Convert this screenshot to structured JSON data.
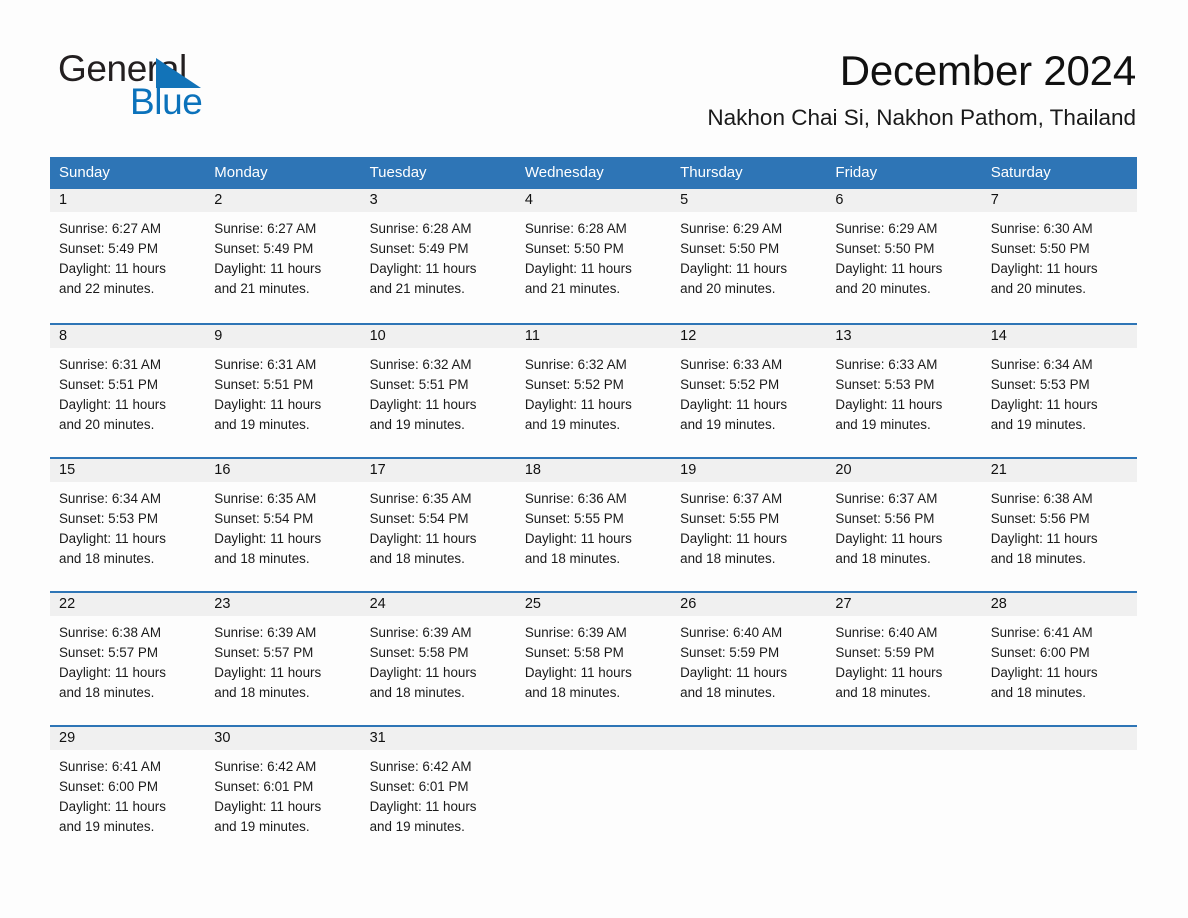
{
  "brand": {
    "word_general": "General",
    "word_blue": "Blue",
    "logo_icon": "triangle-logo-icon",
    "accent_color": "#0b72bb"
  },
  "header": {
    "title": "December 2024",
    "subtitle": "Nakhon Chai Si, Nakhon Pathom, Thailand"
  },
  "theme": {
    "header_blue": "#2e75b6",
    "row_divider_blue": "#2e75b6",
    "daynum_band_gray": "#f0f0f0",
    "page_background": "#fdfdfd"
  },
  "calendar": {
    "weekday_headers": [
      "Sunday",
      "Monday",
      "Tuesday",
      "Wednesday",
      "Thursday",
      "Friday",
      "Saturday"
    ],
    "weeks": [
      [
        {
          "day": "1",
          "sunrise": "Sunrise: 6:27 AM",
          "sunset": "Sunset: 5:49 PM",
          "daylight_line1": "Daylight: 11 hours",
          "daylight_line2": "and 22 minutes."
        },
        {
          "day": "2",
          "sunrise": "Sunrise: 6:27 AM",
          "sunset": "Sunset: 5:49 PM",
          "daylight_line1": "Daylight: 11 hours",
          "daylight_line2": "and 21 minutes."
        },
        {
          "day": "3",
          "sunrise": "Sunrise: 6:28 AM",
          "sunset": "Sunset: 5:49 PM",
          "daylight_line1": "Daylight: 11 hours",
          "daylight_line2": "and 21 minutes."
        },
        {
          "day": "4",
          "sunrise": "Sunrise: 6:28 AM",
          "sunset": "Sunset: 5:50 PM",
          "daylight_line1": "Daylight: 11 hours",
          "daylight_line2": "and 21 minutes."
        },
        {
          "day": "5",
          "sunrise": "Sunrise: 6:29 AM",
          "sunset": "Sunset: 5:50 PM",
          "daylight_line1": "Daylight: 11 hours",
          "daylight_line2": "and 20 minutes."
        },
        {
          "day": "6",
          "sunrise": "Sunrise: 6:29 AM",
          "sunset": "Sunset: 5:50 PM",
          "daylight_line1": "Daylight: 11 hours",
          "daylight_line2": "and 20 minutes."
        },
        {
          "day": "7",
          "sunrise": "Sunrise: 6:30 AM",
          "sunset": "Sunset: 5:50 PM",
          "daylight_line1": "Daylight: 11 hours",
          "daylight_line2": "and 20 minutes."
        }
      ],
      [
        {
          "day": "8",
          "sunrise": "Sunrise: 6:31 AM",
          "sunset": "Sunset: 5:51 PM",
          "daylight_line1": "Daylight: 11 hours",
          "daylight_line2": "and 20 minutes."
        },
        {
          "day": "9",
          "sunrise": "Sunrise: 6:31 AM",
          "sunset": "Sunset: 5:51 PM",
          "daylight_line1": "Daylight: 11 hours",
          "daylight_line2": "and 19 minutes."
        },
        {
          "day": "10",
          "sunrise": "Sunrise: 6:32 AM",
          "sunset": "Sunset: 5:51 PM",
          "daylight_line1": "Daylight: 11 hours",
          "daylight_line2": "and 19 minutes."
        },
        {
          "day": "11",
          "sunrise": "Sunrise: 6:32 AM",
          "sunset": "Sunset: 5:52 PM",
          "daylight_line1": "Daylight: 11 hours",
          "daylight_line2": "and 19 minutes."
        },
        {
          "day": "12",
          "sunrise": "Sunrise: 6:33 AM",
          "sunset": "Sunset: 5:52 PM",
          "daylight_line1": "Daylight: 11 hours",
          "daylight_line2": "and 19 minutes."
        },
        {
          "day": "13",
          "sunrise": "Sunrise: 6:33 AM",
          "sunset": "Sunset: 5:53 PM",
          "daylight_line1": "Daylight: 11 hours",
          "daylight_line2": "and 19 minutes."
        },
        {
          "day": "14",
          "sunrise": "Sunrise: 6:34 AM",
          "sunset": "Sunset: 5:53 PM",
          "daylight_line1": "Daylight: 11 hours",
          "daylight_line2": "and 19 minutes."
        }
      ],
      [
        {
          "day": "15",
          "sunrise": "Sunrise: 6:34 AM",
          "sunset": "Sunset: 5:53 PM",
          "daylight_line1": "Daylight: 11 hours",
          "daylight_line2": "and 18 minutes."
        },
        {
          "day": "16",
          "sunrise": "Sunrise: 6:35 AM",
          "sunset": "Sunset: 5:54 PM",
          "daylight_line1": "Daylight: 11 hours",
          "daylight_line2": "and 18 minutes."
        },
        {
          "day": "17",
          "sunrise": "Sunrise: 6:35 AM",
          "sunset": "Sunset: 5:54 PM",
          "daylight_line1": "Daylight: 11 hours",
          "daylight_line2": "and 18 minutes."
        },
        {
          "day": "18",
          "sunrise": "Sunrise: 6:36 AM",
          "sunset": "Sunset: 5:55 PM",
          "daylight_line1": "Daylight: 11 hours",
          "daylight_line2": "and 18 minutes."
        },
        {
          "day": "19",
          "sunrise": "Sunrise: 6:37 AM",
          "sunset": "Sunset: 5:55 PM",
          "daylight_line1": "Daylight: 11 hours",
          "daylight_line2": "and 18 minutes."
        },
        {
          "day": "20",
          "sunrise": "Sunrise: 6:37 AM",
          "sunset": "Sunset: 5:56 PM",
          "daylight_line1": "Daylight: 11 hours",
          "daylight_line2": "and 18 minutes."
        },
        {
          "day": "21",
          "sunrise": "Sunrise: 6:38 AM",
          "sunset": "Sunset: 5:56 PM",
          "daylight_line1": "Daylight: 11 hours",
          "daylight_line2": "and 18 minutes."
        }
      ],
      [
        {
          "day": "22",
          "sunrise": "Sunrise: 6:38 AM",
          "sunset": "Sunset: 5:57 PM",
          "daylight_line1": "Daylight: 11 hours",
          "daylight_line2": "and 18 minutes."
        },
        {
          "day": "23",
          "sunrise": "Sunrise: 6:39 AM",
          "sunset": "Sunset: 5:57 PM",
          "daylight_line1": "Daylight: 11 hours",
          "daylight_line2": "and 18 minutes."
        },
        {
          "day": "24",
          "sunrise": "Sunrise: 6:39 AM",
          "sunset": "Sunset: 5:58 PM",
          "daylight_line1": "Daylight: 11 hours",
          "daylight_line2": "and 18 minutes."
        },
        {
          "day": "25",
          "sunrise": "Sunrise: 6:39 AM",
          "sunset": "Sunset: 5:58 PM",
          "daylight_line1": "Daylight: 11 hours",
          "daylight_line2": "and 18 minutes."
        },
        {
          "day": "26",
          "sunrise": "Sunrise: 6:40 AM",
          "sunset": "Sunset: 5:59 PM",
          "daylight_line1": "Daylight: 11 hours",
          "daylight_line2": "and 18 minutes."
        },
        {
          "day": "27",
          "sunrise": "Sunrise: 6:40 AM",
          "sunset": "Sunset: 5:59 PM",
          "daylight_line1": "Daylight: 11 hours",
          "daylight_line2": "and 18 minutes."
        },
        {
          "day": "28",
          "sunrise": "Sunrise: 6:41 AM",
          "sunset": "Sunset: 6:00 PM",
          "daylight_line1": "Daylight: 11 hours",
          "daylight_line2": "and 18 minutes."
        }
      ],
      [
        {
          "day": "29",
          "sunrise": "Sunrise: 6:41 AM",
          "sunset": "Sunset: 6:00 PM",
          "daylight_line1": "Daylight: 11 hours",
          "daylight_line2": "and 19 minutes."
        },
        {
          "day": "30",
          "sunrise": "Sunrise: 6:42 AM",
          "sunset": "Sunset: 6:01 PM",
          "daylight_line1": "Daylight: 11 hours",
          "daylight_line2": "and 19 minutes."
        },
        {
          "day": "31",
          "sunrise": "Sunrise: 6:42 AM",
          "sunset": "Sunset: 6:01 PM",
          "daylight_line1": "Daylight: 11 hours",
          "daylight_line2": "and 19 minutes."
        },
        {
          "day": "",
          "sunrise": "",
          "sunset": "",
          "daylight_line1": "",
          "daylight_line2": ""
        },
        {
          "day": "",
          "sunrise": "",
          "sunset": "",
          "daylight_line1": "",
          "daylight_line2": ""
        },
        {
          "day": "",
          "sunrise": "",
          "sunset": "",
          "daylight_line1": "",
          "daylight_line2": ""
        },
        {
          "day": "",
          "sunrise": "",
          "sunset": "",
          "daylight_line1": "",
          "daylight_line2": ""
        }
      ]
    ]
  }
}
